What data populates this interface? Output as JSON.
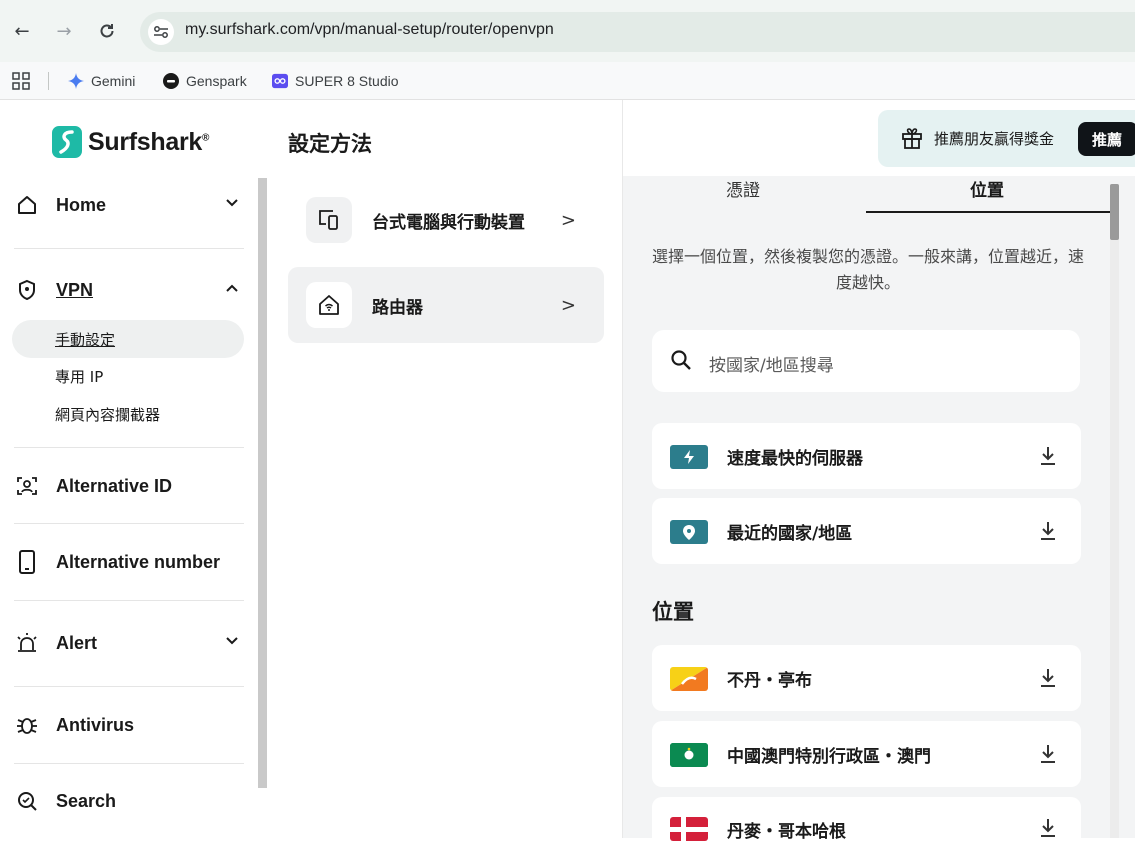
{
  "browser": {
    "url": "my.surfshark.com/vpn/manual-setup/router/openvpn",
    "bookmarks": [
      {
        "label": "Gemini",
        "icon": "gemini-icon"
      },
      {
        "label": "Genspark",
        "icon": "genspark-icon"
      },
      {
        "label": "SUPER 8 Studio",
        "icon": "super8-icon"
      }
    ]
  },
  "brand": {
    "name": "Surfshark",
    "reg": "®",
    "accent": "#1ebaa6"
  },
  "sidebar": {
    "home": "Home",
    "vpn": "VPN",
    "vpn_sub": [
      "手動設定",
      "專用 IP",
      "網頁內容攔截器"
    ],
    "alt_id": "Alternative ID",
    "alt_number": "Alternative number",
    "alert": "Alert",
    "antivirus": "Antivirus",
    "search": "Search"
  },
  "middle": {
    "title": "設定方法",
    "options": [
      "台式電腦與行動裝置",
      "路由器"
    ]
  },
  "right": {
    "refer_text": "推薦朋友贏得獎金",
    "refer_button": "推薦",
    "tabs": [
      "憑證",
      "位置"
    ],
    "instructions": "選擇一個位置，然後複製您的憑證。一般來講，位置越近，速度越快。",
    "search_placeholder": "按國家/地區搜尋",
    "quick": [
      {
        "label": "速度最快的伺服器",
        "icon": "lightning-icon"
      },
      {
        "label": "最近的國家/地區",
        "icon": "location-pin-icon"
      }
    ],
    "section_title": "位置",
    "locations": [
      {
        "label": "不丹・亭布",
        "flag": "bhutan-flag"
      },
      {
        "label": "中國澳門特別行政區・澳門",
        "flag": "macau-flag"
      },
      {
        "label": "丹麥・哥本哈根",
        "flag": "denmark-flag"
      }
    ]
  }
}
